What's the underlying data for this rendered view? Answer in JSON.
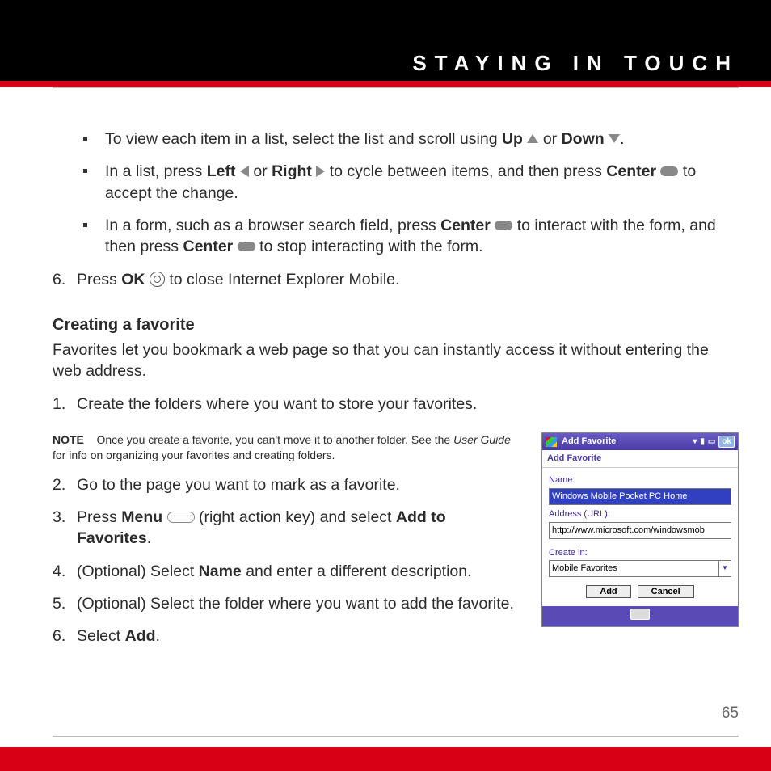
{
  "header": {
    "section_title": "STAYING IN TOUCH"
  },
  "body": {
    "bullets": [
      {
        "before_up": "To view each item in a list, select the list and scroll using ",
        "up": "Up",
        "mid": " or ",
        "down": "Down",
        "after": "."
      },
      {
        "t1": "In a list, press ",
        "left": "Left",
        "t2": " or ",
        "right": "Right",
        "t3": " to cycle between items, and then press ",
        "center": "Center",
        "t4": " to accept the change."
      },
      {
        "t1": "In a form, such as a browser search field, press ",
        "center1": "Center",
        "t2": " to interact with the form, and then press ",
        "center2": "Center",
        "t3": " to stop interacting with the form."
      }
    ],
    "continue_step": {
      "num": "6.",
      "t1": "Press ",
      "ok": "OK",
      "t2": " to close Internet Explorer Mobile."
    },
    "heading": "Creating a favorite",
    "intro": "Favorites let you bookmark a web page so that you can instantly access it without entering the web address.",
    "steps": {
      "s1": {
        "num": "1.",
        "text": "Create the folders where you want to store your favorites."
      },
      "note": {
        "label": "NOTE",
        "t1": "Once you create a favorite, you can't move it to another folder. See the ",
        "italic": "User Guide",
        "t2": " for info on organizing your favorites and creating folders."
      },
      "s2": {
        "num": "2.",
        "text": "Go to the page you want to mark as a favorite."
      },
      "s3": {
        "num": "3.",
        "t1": "Press ",
        "menu": "Menu",
        "t2": " (right action key) and select ",
        "add": "Add to Favorites",
        "t3": "."
      },
      "s4": {
        "num": "4.",
        "t1": "(Optional) Select ",
        "bold": "Name",
        "t2": " and enter a different description."
      },
      "s5": {
        "num": "5.",
        "text": "(Optional) Select the folder where you want to add the favorite."
      },
      "s6": {
        "num": "6.",
        "t1": "Select ",
        "bold": "Add",
        "t2": "."
      }
    }
  },
  "inset": {
    "title": "Add Favorite",
    "ok": "ok",
    "subhead": "Add Favorite",
    "labels": {
      "name": "Name:",
      "url": "Address (URL):",
      "createin": "Create in:"
    },
    "values": {
      "name": "Windows Mobile Pocket PC Home",
      "url": "http://www.microsoft.com/windowsmob",
      "createin": "Mobile Favorites"
    },
    "buttons": {
      "add": "Add",
      "cancel": "Cancel"
    }
  },
  "page_number": "65"
}
